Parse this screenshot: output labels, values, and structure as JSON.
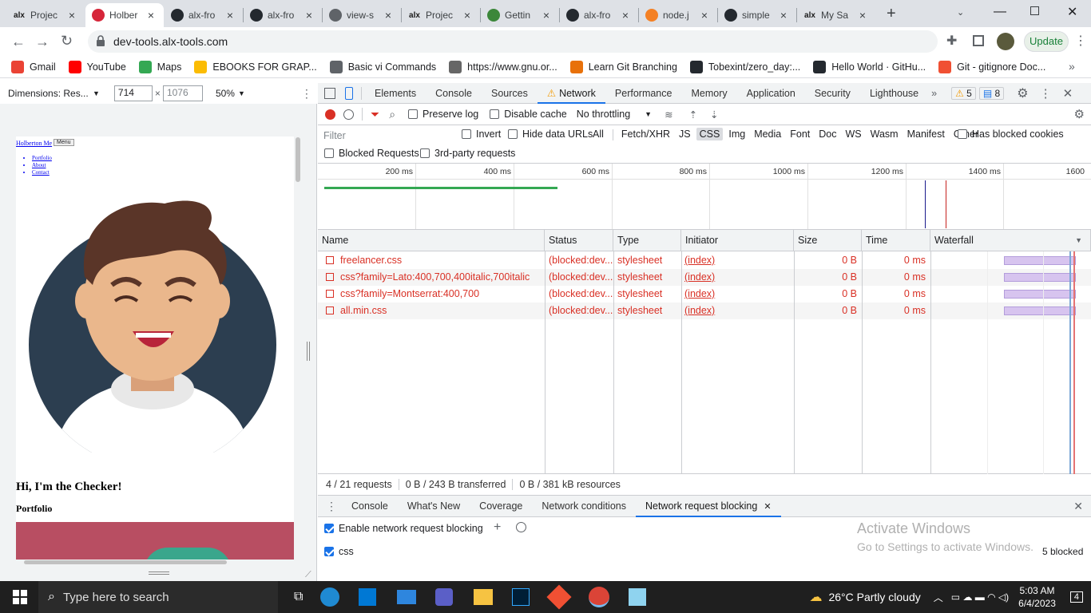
{
  "browser": {
    "tabs": [
      {
        "title": "Projec",
        "favicon": "alx-favicon"
      },
      {
        "title": "Holber",
        "favicon": "holberton-favicon",
        "active": true
      },
      {
        "title": "alx-fro",
        "favicon": "github-favicon"
      },
      {
        "title": "alx-fro",
        "favicon": "github-favicon"
      },
      {
        "title": "view-s",
        "favicon": "globe-favicon"
      },
      {
        "title": "Projec",
        "favicon": "alx-favicon"
      },
      {
        "title": "Gettin",
        "favicon": "node-favicon"
      },
      {
        "title": "alx-fro",
        "favicon": "github-favicon"
      },
      {
        "title": "node.j",
        "favicon": "stackoverflow-favicon"
      },
      {
        "title": "simple",
        "favicon": "github-favicon"
      },
      {
        "title": "My Sa",
        "favicon": "alx-favicon"
      }
    ],
    "alx_logo_text": "alx",
    "url": "dev-tools.alx-tools.com",
    "update_label": "Update",
    "bookmarks": [
      {
        "label": "Gmail",
        "color": "#ea4335"
      },
      {
        "label": "YouTube",
        "color": "#ff0000"
      },
      {
        "label": "Maps",
        "color": "#34a853"
      },
      {
        "label": "EBOOKS FOR GRAP...",
        "color": "#fbbc04"
      },
      {
        "label": "Basic vi Commands",
        "color": "#5f6368"
      },
      {
        "label": "https://www.gnu.or...",
        "color": "#666666"
      },
      {
        "label": "Learn Git Branching",
        "color": "#e8710a"
      },
      {
        "label": "Tobexint/zero_day:...",
        "color": "#24292f"
      },
      {
        "label": "Hello World · GitHu...",
        "color": "#24292f"
      },
      {
        "label": "Git - gitignore Doc...",
        "color": "#f05033"
      }
    ]
  },
  "device_toolbar": {
    "dimensions_label": "Dimensions: Res...",
    "width": "714",
    "times": "×",
    "height": "1076",
    "zoom": "50%"
  },
  "preview": {
    "brand": "Holberton Me",
    "menu_label": "Menu",
    "nav": [
      "Portfolio",
      "About",
      "Contact"
    ],
    "heading": "Hi, I'm the Checker!",
    "section": "Portfolio",
    "avatar_bg": "#2c3e50",
    "portfolio_bg": "#b84e62"
  },
  "devtools": {
    "tabs": [
      "Elements",
      "Console",
      "Sources",
      "Network",
      "Performance",
      "Memory",
      "Application",
      "Security",
      "Lighthouse"
    ],
    "active_tab": "Network",
    "more": "»",
    "warnings": "5",
    "messages": "8",
    "network_toolbar": {
      "preserve_log": "Preserve log",
      "disable_cache": "Disable cache",
      "throttling": "No throttling"
    },
    "filter": {
      "placeholder": "Filter",
      "invert": "Invert",
      "hide_data_urls": "Hide data URLs",
      "types": [
        "All",
        "Fetch/XHR",
        "JS",
        "CSS",
        "Img",
        "Media",
        "Font",
        "Doc",
        "WS",
        "Wasm",
        "Manifest",
        "Other"
      ],
      "active_type": "CSS",
      "has_blocked_cookies": "Has blocked cookies",
      "blocked_requests": "Blocked Requests",
      "third_party": "3rd-party requests"
    },
    "timeline_ticks": [
      "200 ms",
      "400 ms",
      "600 ms",
      "800 ms",
      "1000 ms",
      "1200 ms",
      "1400 ms",
      "1600"
    ],
    "columns": [
      "Name",
      "Status",
      "Type",
      "Initiator",
      "Size",
      "Time",
      "Waterfall"
    ],
    "requests": [
      {
        "name": "freelancer.css",
        "status": "(blocked:dev...",
        "type": "stylesheet",
        "initiator": "(index)",
        "size": "0 B",
        "time": "0 ms"
      },
      {
        "name": "css?family=Lato:400,700,400italic,700italic",
        "status": "(blocked:dev...",
        "type": "stylesheet",
        "initiator": "(index)",
        "size": "0 B",
        "time": "0 ms"
      },
      {
        "name": "css?family=Montserrat:400,700",
        "status": "(blocked:dev...",
        "type": "stylesheet",
        "initiator": "(index)",
        "size": "0 B",
        "time": "0 ms"
      },
      {
        "name": "all.min.css",
        "status": "(blocked:dev...",
        "type": "stylesheet",
        "initiator": "(index)",
        "size": "0 B",
        "time": "0 ms"
      }
    ],
    "status": {
      "requests": "4 / 21 requests",
      "transferred": "0 B / 243 B transferred",
      "resources": "0 B / 381 kB resources"
    },
    "drawer_tabs": [
      "Console",
      "What's New",
      "Coverage",
      "Network conditions",
      "Network request blocking"
    ],
    "active_drawer_tab": "Network request blocking",
    "enable_blocking": "Enable network request blocking",
    "pattern": "css",
    "blocked_count": "5 blocked",
    "watermark_title": "Activate Windows",
    "watermark_sub": "Go to Settings to activate Windows."
  },
  "taskbar": {
    "search_placeholder": "Type here to search",
    "weather": "26°C  Partly cloudy",
    "time": "5:03 AM",
    "date": "6/4/2023",
    "notifications": "4"
  }
}
